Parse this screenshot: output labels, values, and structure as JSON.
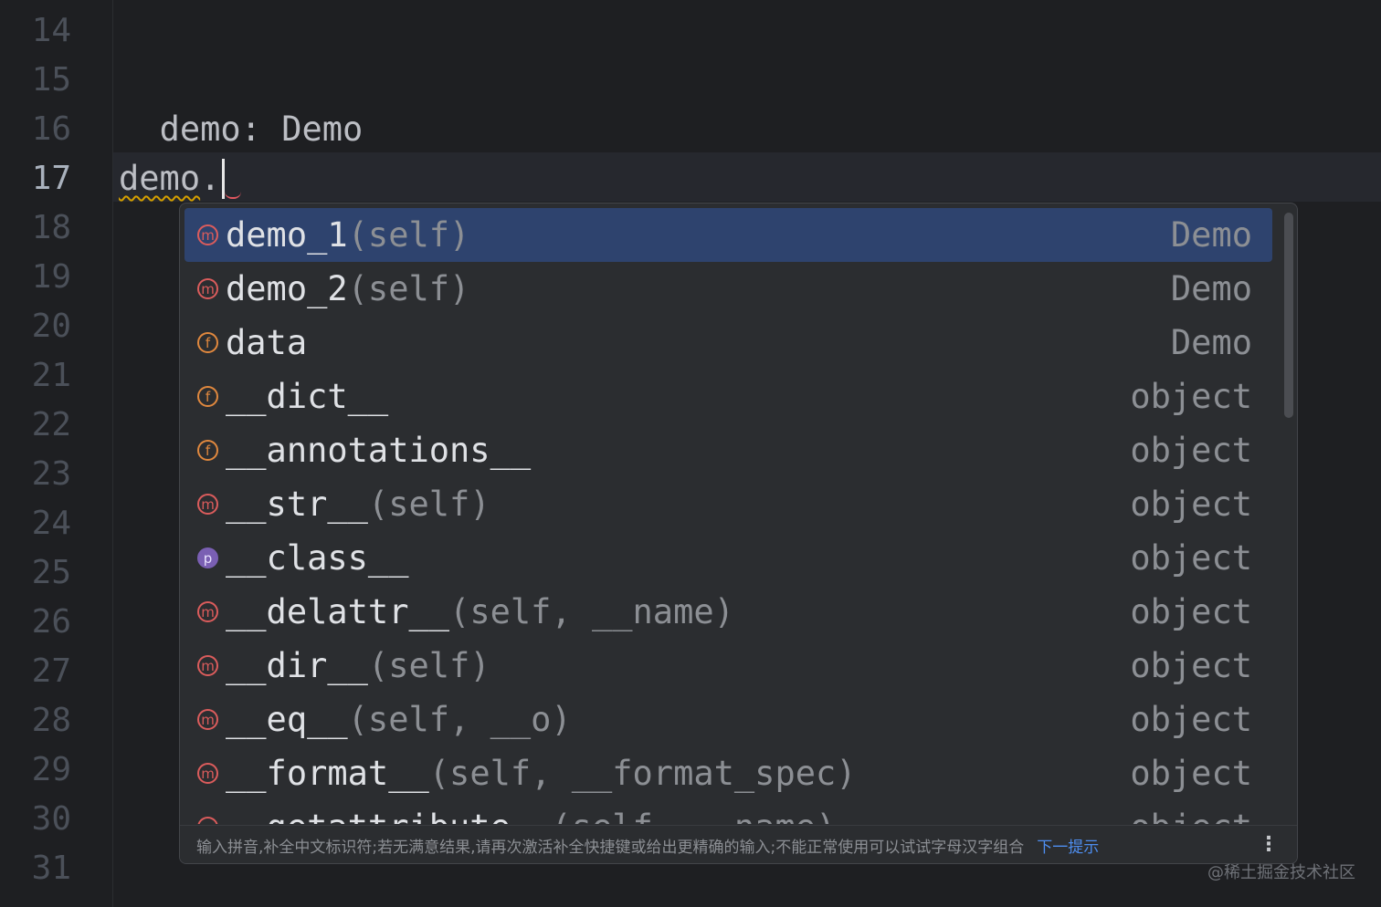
{
  "editor": {
    "line_numbers": [
      "14",
      "15",
      "16",
      "17",
      "18",
      "19",
      "20",
      "21",
      "22",
      "23",
      "24",
      "25",
      "26",
      "27",
      "28",
      "29",
      "30",
      "31"
    ],
    "current_line": "17",
    "code": {
      "line15": "demo: Demo",
      "line17_text": "demo",
      "line17_dot": "."
    }
  },
  "completion": {
    "items": [
      {
        "icon": "method-icon",
        "glyph": "m",
        "name": "demo_1",
        "params": "(self)",
        "type": "Demo",
        "selected": true
      },
      {
        "icon": "method-icon",
        "glyph": "m",
        "name": "demo_2",
        "params": "(self)",
        "type": "Demo"
      },
      {
        "icon": "field-icon",
        "glyph": "f",
        "name": "data",
        "params": "",
        "type": "Demo"
      },
      {
        "icon": "field-icon",
        "glyph": "f",
        "name": "__dict__",
        "params": "",
        "type": "object"
      },
      {
        "icon": "field-icon",
        "glyph": "f",
        "name": "__annotations__",
        "params": "",
        "type": "object"
      },
      {
        "icon": "method-icon",
        "glyph": "m",
        "name": "__str__",
        "params": "(self)",
        "type": "object"
      },
      {
        "icon": "property-icon",
        "glyph": "p",
        "name": "__class__",
        "params": "",
        "type": "object"
      },
      {
        "icon": "method-icon",
        "glyph": "m",
        "name": "__delattr__",
        "params": "(self, __name)",
        "type": "object"
      },
      {
        "icon": "method-icon",
        "glyph": "m",
        "name": "__dir__",
        "params": "(self)",
        "type": "object"
      },
      {
        "icon": "method-icon",
        "glyph": "m",
        "name": "__eq__",
        "params": "(self, __o)",
        "type": "object"
      },
      {
        "icon": "method-icon",
        "glyph": "m",
        "name": "__format__",
        "params": "(self, __format_spec)",
        "type": "object"
      },
      {
        "icon": "method-icon",
        "glyph": "m",
        "name": "__getattribute__",
        "params": "(self, __name)",
        "type": "object"
      }
    ],
    "footer": {
      "hint": "输入拼音,补全中文标识符;若无满意结果,请再次激活补全快捷键或给出更精确的输入;不能正常使用可以试试字母汉字组合",
      "next_hint": "下一提示",
      "more": "⋮"
    }
  },
  "watermark": "@稀土掘金技术社区"
}
